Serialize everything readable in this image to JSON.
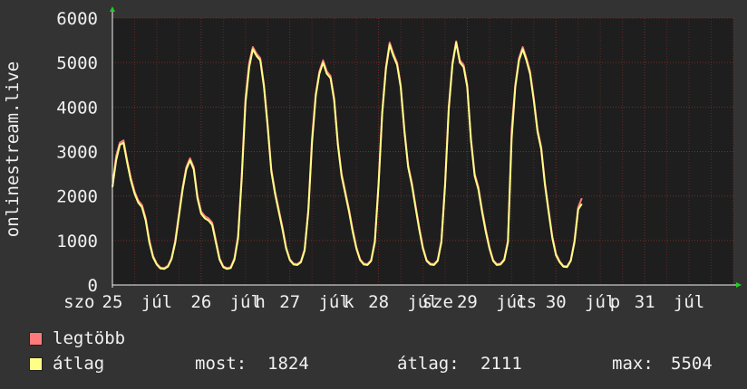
{
  "ylabel": "onlinestream.live",
  "colors": {
    "background": "#333333",
    "plot_bg": "#1e1e1e",
    "grid": "#7a2a2a",
    "legtobb": "#ff7b7b",
    "atlag": "#ffff88",
    "text": "#f0f0f0",
    "arrow": "#22cc22"
  },
  "legend": [
    {
      "label": "legtöbb",
      "color": "#ff7b7b"
    },
    {
      "label": "átlag",
      "color": "#ffff88"
    }
  ],
  "stats": [
    {
      "label": "most:",
      "value": "1824"
    },
    {
      "label": "átlag:",
      "value": "2111"
    },
    {
      "label": "max:",
      "value": "5504"
    }
  ],
  "chart_data": {
    "type": "line",
    "ylim": [
      0,
      6000
    ],
    "xlim": [
      0,
      168
    ],
    "y_ticks": [
      0,
      1000,
      2000,
      3000,
      4000,
      5000,
      6000
    ],
    "x_ticks": [
      {
        "label": "szo",
        "x": -9
      },
      {
        "label": "25",
        "x": 0
      },
      {
        "label": "júl",
        "x": 12
      },
      {
        "label": "26",
        "x": 24
      },
      {
        "label": "júl",
        "x": 36
      },
      {
        "label": "h",
        "x": 40
      },
      {
        "label": "27",
        "x": 48
      },
      {
        "label": "júl",
        "x": 60
      },
      {
        "label": "k",
        "x": 64
      },
      {
        "label": "28",
        "x": 72
      },
      {
        "label": "júl",
        "x": 84
      },
      {
        "label": "sze",
        "x": 88
      },
      {
        "label": "29",
        "x": 96
      },
      {
        "label": "júl",
        "x": 108
      },
      {
        "label": "cs",
        "x": 112
      },
      {
        "label": "30",
        "x": 120
      },
      {
        "label": "júl",
        "x": 132
      },
      {
        "label": "p",
        "x": 136
      },
      {
        "label": "31",
        "x": 144
      },
      {
        "label": "júl",
        "x": 156
      }
    ],
    "grid": true,
    "legend_position": "bottom-left",
    "series": [
      {
        "name": "legtöbb",
        "points": [
          [
            0,
            2200
          ],
          [
            1,
            2900
          ],
          [
            2,
            3200
          ],
          [
            3,
            3250
          ],
          [
            4,
            2800
          ],
          [
            5,
            2400
          ],
          [
            6,
            2100
          ],
          [
            7,
            1900
          ],
          [
            8,
            1800
          ],
          [
            9,
            1500
          ],
          [
            10,
            1000
          ],
          [
            11,
            650
          ],
          [
            12,
            480
          ],
          [
            13,
            390
          ],
          [
            14,
            380
          ],
          [
            15,
            430
          ],
          [
            16,
            600
          ],
          [
            17,
            1000
          ],
          [
            18,
            1600
          ],
          [
            19,
            2200
          ],
          [
            20,
            2650
          ],
          [
            21,
            2850
          ],
          [
            22,
            2650
          ],
          [
            23,
            2000
          ],
          [
            24,
            1650
          ],
          [
            25,
            1550
          ],
          [
            26,
            1500
          ],
          [
            27,
            1400
          ],
          [
            28,
            1000
          ],
          [
            29,
            600
          ],
          [
            30,
            420
          ],
          [
            31,
            380
          ],
          [
            32,
            400
          ],
          [
            33,
            600
          ],
          [
            34,
            1100
          ],
          [
            35,
            2500
          ],
          [
            36,
            4200
          ],
          [
            37,
            5000
          ],
          [
            38,
            5350
          ],
          [
            39,
            5200
          ],
          [
            40,
            5100
          ],
          [
            41,
            4500
          ],
          [
            42,
            3600
          ],
          [
            43,
            2600
          ],
          [
            44,
            2100
          ],
          [
            45,
            1700
          ],
          [
            46,
            1300
          ],
          [
            47,
            850
          ],
          [
            48,
            580
          ],
          [
            49,
            480
          ],
          [
            50,
            470
          ],
          [
            51,
            530
          ],
          [
            52,
            800
          ],
          [
            53,
            1700
          ],
          [
            54,
            3300
          ],
          [
            55,
            4300
          ],
          [
            56,
            4800
          ],
          [
            57,
            5050
          ],
          [
            58,
            4800
          ],
          [
            59,
            4700
          ],
          [
            60,
            4200
          ],
          [
            61,
            3200
          ],
          [
            62,
            2500
          ],
          [
            63,
            2100
          ],
          [
            64,
            1700
          ],
          [
            65,
            1250
          ],
          [
            66,
            850
          ],
          [
            67,
            580
          ],
          [
            68,
            480
          ],
          [
            69,
            470
          ],
          [
            70,
            560
          ],
          [
            71,
            1000
          ],
          [
            72,
            2300
          ],
          [
            73,
            3900
          ],
          [
            74,
            4900
          ],
          [
            75,
            5450
          ],
          [
            76,
            5200
          ],
          [
            77,
            5000
          ],
          [
            78,
            4500
          ],
          [
            79,
            3500
          ],
          [
            80,
            2700
          ],
          [
            81,
            2300
          ],
          [
            82,
            1800
          ],
          [
            83,
            1300
          ],
          [
            84,
            850
          ],
          [
            85,
            560
          ],
          [
            86,
            480
          ],
          [
            87,
            470
          ],
          [
            88,
            560
          ],
          [
            89,
            1000
          ],
          [
            90,
            2300
          ],
          [
            91,
            4000
          ],
          [
            92,
            5000
          ],
          [
            93,
            5480
          ],
          [
            94,
            5050
          ],
          [
            95,
            4950
          ],
          [
            96,
            4500
          ],
          [
            97,
            3300
          ],
          [
            98,
            2500
          ],
          [
            99,
            2200
          ],
          [
            100,
            1700
          ],
          [
            101,
            1250
          ],
          [
            102,
            850
          ],
          [
            103,
            560
          ],
          [
            104,
            470
          ],
          [
            105,
            480
          ],
          [
            106,
            580
          ],
          [
            107,
            1000
          ],
          [
            108,
            3500
          ],
          [
            109,
            4500
          ],
          [
            110,
            5100
          ],
          [
            111,
            5350
          ],
          [
            112,
            5100
          ],
          [
            113,
            4800
          ],
          [
            114,
            4200
          ],
          [
            115,
            3500
          ],
          [
            116,
            3100
          ],
          [
            117,
            2300
          ],
          [
            118,
            1700
          ],
          [
            119,
            1100
          ],
          [
            120,
            700
          ],
          [
            121,
            530
          ],
          [
            122,
            430
          ],
          [
            123,
            420
          ],
          [
            124,
            560
          ],
          [
            125,
            1000
          ],
          [
            126,
            1750
          ],
          [
            127,
            1950
          ]
        ]
      },
      {
        "name": "átlag",
        "points": [
          [
            0,
            2200
          ],
          [
            1,
            2800
          ],
          [
            2,
            3150
          ],
          [
            3,
            3200
          ],
          [
            4,
            2750
          ],
          [
            5,
            2350
          ],
          [
            6,
            2050
          ],
          [
            7,
            1850
          ],
          [
            8,
            1750
          ],
          [
            9,
            1450
          ],
          [
            10,
            950
          ],
          [
            11,
            620
          ],
          [
            12,
            460
          ],
          [
            13,
            370
          ],
          [
            14,
            360
          ],
          [
            15,
            410
          ],
          [
            16,
            580
          ],
          [
            17,
            950
          ],
          [
            18,
            1550
          ],
          [
            19,
            2150
          ],
          [
            20,
            2600
          ],
          [
            21,
            2800
          ],
          [
            22,
            2600
          ],
          [
            23,
            1950
          ],
          [
            24,
            1600
          ],
          [
            25,
            1500
          ],
          [
            26,
            1450
          ],
          [
            27,
            1350
          ],
          [
            28,
            950
          ],
          [
            29,
            570
          ],
          [
            30,
            400
          ],
          [
            31,
            360
          ],
          [
            32,
            380
          ],
          [
            33,
            570
          ],
          [
            34,
            1050
          ],
          [
            35,
            2400
          ],
          [
            36,
            4100
          ],
          [
            37,
            4900
          ],
          [
            38,
            5300
          ],
          [
            39,
            5150
          ],
          [
            40,
            5050
          ],
          [
            41,
            4450
          ],
          [
            42,
            3550
          ],
          [
            43,
            2550
          ],
          [
            44,
            2050
          ],
          [
            45,
            1650
          ],
          [
            46,
            1250
          ],
          [
            47,
            820
          ],
          [
            48,
            560
          ],
          [
            49,
            460
          ],
          [
            50,
            450
          ],
          [
            51,
            510
          ],
          [
            52,
            770
          ],
          [
            53,
            1650
          ],
          [
            54,
            3200
          ],
          [
            55,
            4250
          ],
          [
            56,
            4750
          ],
          [
            57,
            5000
          ],
          [
            58,
            4750
          ],
          [
            59,
            4650
          ],
          [
            60,
            4150
          ],
          [
            61,
            3150
          ],
          [
            62,
            2450
          ],
          [
            63,
            2050
          ],
          [
            64,
            1650
          ],
          [
            65,
            1200
          ],
          [
            66,
            820
          ],
          [
            67,
            560
          ],
          [
            68,
            460
          ],
          [
            69,
            450
          ],
          [
            70,
            540
          ],
          [
            71,
            960
          ],
          [
            72,
            2250
          ],
          [
            73,
            3850
          ],
          [
            74,
            4850
          ],
          [
            75,
            5400
          ],
          [
            76,
            5150
          ],
          [
            77,
            4950
          ],
          [
            78,
            4450
          ],
          [
            79,
            3450
          ],
          [
            80,
            2650
          ],
          [
            81,
            2250
          ],
          [
            82,
            1750
          ],
          [
            83,
            1250
          ],
          [
            84,
            820
          ],
          [
            85,
            540
          ],
          [
            86,
            460
          ],
          [
            87,
            450
          ],
          [
            88,
            540
          ],
          [
            89,
            960
          ],
          [
            90,
            2250
          ],
          [
            91,
            3950
          ],
          [
            92,
            4950
          ],
          [
            93,
            5450
          ],
          [
            94,
            5000
          ],
          [
            95,
            4900
          ],
          [
            96,
            4450
          ],
          [
            97,
            3250
          ],
          [
            98,
            2450
          ],
          [
            99,
            2150
          ],
          [
            100,
            1650
          ],
          [
            101,
            1200
          ],
          [
            102,
            820
          ],
          [
            103,
            540
          ],
          [
            104,
            450
          ],
          [
            105,
            460
          ],
          [
            106,
            560
          ],
          [
            107,
            960
          ],
          [
            108,
            3300
          ],
          [
            109,
            4450
          ],
          [
            110,
            5050
          ],
          [
            111,
            5300
          ],
          [
            112,
            5050
          ],
          [
            113,
            4750
          ],
          [
            114,
            4150
          ],
          [
            115,
            3450
          ],
          [
            116,
            3050
          ],
          [
            117,
            2250
          ],
          [
            118,
            1650
          ],
          [
            119,
            1060
          ],
          [
            120,
            670
          ],
          [
            121,
            510
          ],
          [
            122,
            410
          ],
          [
            123,
            400
          ],
          [
            124,
            540
          ],
          [
            125,
            960
          ],
          [
            126,
            1700
          ],
          [
            127,
            1824
          ]
        ]
      }
    ]
  }
}
